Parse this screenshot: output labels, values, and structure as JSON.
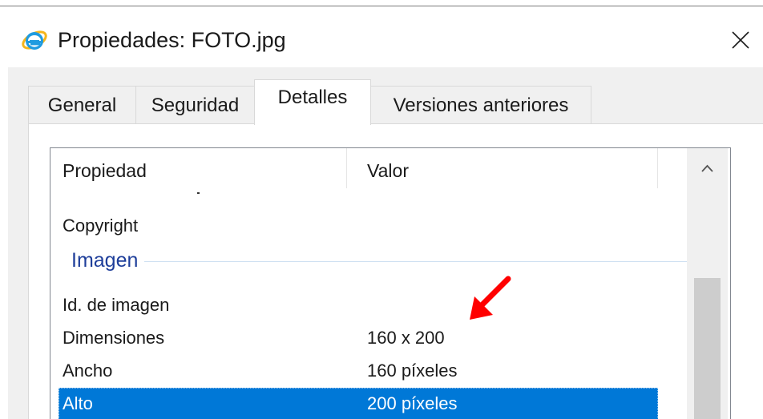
{
  "window": {
    "title": "Propiedades: FOTO.jpg",
    "app_icon": "internet-explorer-icon",
    "close_icon": "close-icon"
  },
  "tabs": [
    {
      "label": "General",
      "active": false
    },
    {
      "label": "Seguridad",
      "active": false
    },
    {
      "label": "Detalles",
      "active": true
    },
    {
      "label": "Versiones anteriores",
      "active": false
    }
  ],
  "details": {
    "columns": {
      "property": "Propiedad",
      "value": "Valor"
    },
    "rows_before_group": [
      {
        "property": "Copyright",
        "value": ""
      }
    ],
    "group": {
      "label": "Imagen"
    },
    "rows": [
      {
        "property": "Id. de imagen",
        "value": "",
        "selected": false
      },
      {
        "property": "Dimensiones",
        "value": "160 x 200",
        "selected": false
      },
      {
        "property": "Ancho",
        "value": "160 píxeles",
        "selected": false
      },
      {
        "property": "Alto",
        "value": "200 píxeles",
        "selected": true
      }
    ]
  },
  "colors": {
    "selection": "#0078d7",
    "group_label": "#1e3e9a",
    "annotation_arrow": "#ff0000"
  },
  "annotation": {
    "icon": "red-arrow-icon"
  }
}
